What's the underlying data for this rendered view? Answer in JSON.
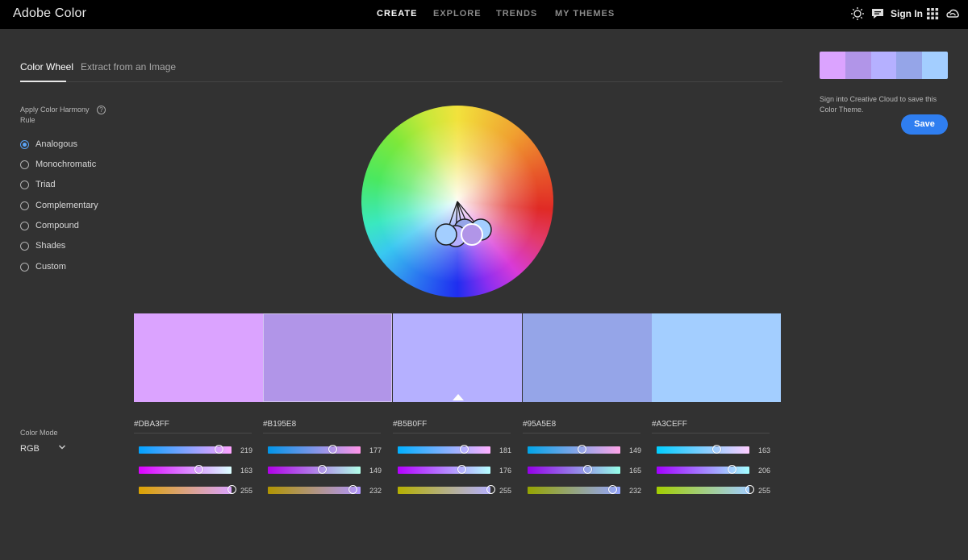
{
  "app": {
    "title": "Adobe Color"
  },
  "nav": [
    {
      "label": "CREATE",
      "active": true
    },
    {
      "label": "EXPLORE",
      "active": false
    },
    {
      "label": "TRENDS",
      "active": false
    },
    {
      "label": "MY THEMES",
      "active": false
    }
  ],
  "topbar": {
    "sign_in": "Sign In",
    "icons": [
      "brightness-icon",
      "feedback-icon",
      "apps-grid-icon",
      "creative-cloud-icon"
    ]
  },
  "tabs": [
    {
      "label": "Color Wheel",
      "active": true
    },
    {
      "label": "Extract from an Image",
      "active": false
    }
  ],
  "harmony": {
    "label": "Apply Color Harmony Rule",
    "help_icon": "?",
    "selected": "Analogous",
    "options": [
      "Analogous",
      "Monochromatic",
      "Triad",
      "Complementary",
      "Compound",
      "Shades",
      "Custom"
    ]
  },
  "color_mode": {
    "label": "Color Mode",
    "value": "RGB"
  },
  "swatches": [
    {
      "hex": "#DBA3FF",
      "color": "#DBA3FF",
      "r": 219,
      "g": 163,
      "b": 255,
      "selected": false
    },
    {
      "hex": "#B195E8",
      "color": "#B195E8",
      "r": 177,
      "g": 149,
      "b": 232,
      "selected": true
    },
    {
      "hex": "#B5B0FF",
      "color": "#B5B0FF",
      "r": 181,
      "g": 176,
      "b": 255,
      "selected": false
    },
    {
      "hex": "#95A5E8",
      "color": "#95A5E8",
      "r": 149,
      "g": 165,
      "b": 232,
      "selected": false
    },
    {
      "hex": "#A3CEFF",
      "color": "#A3CEFF",
      "r": 163,
      "g": 206,
      "b": 255,
      "selected": false
    }
  ],
  "right_panel": {
    "sign_message": "Sign into Creative Cloud to save this Color Theme.",
    "save_label": "Save"
  },
  "colors": {
    "accent": "#2F7EF0",
    "background": "#323232",
    "topbar": "#000000"
  }
}
